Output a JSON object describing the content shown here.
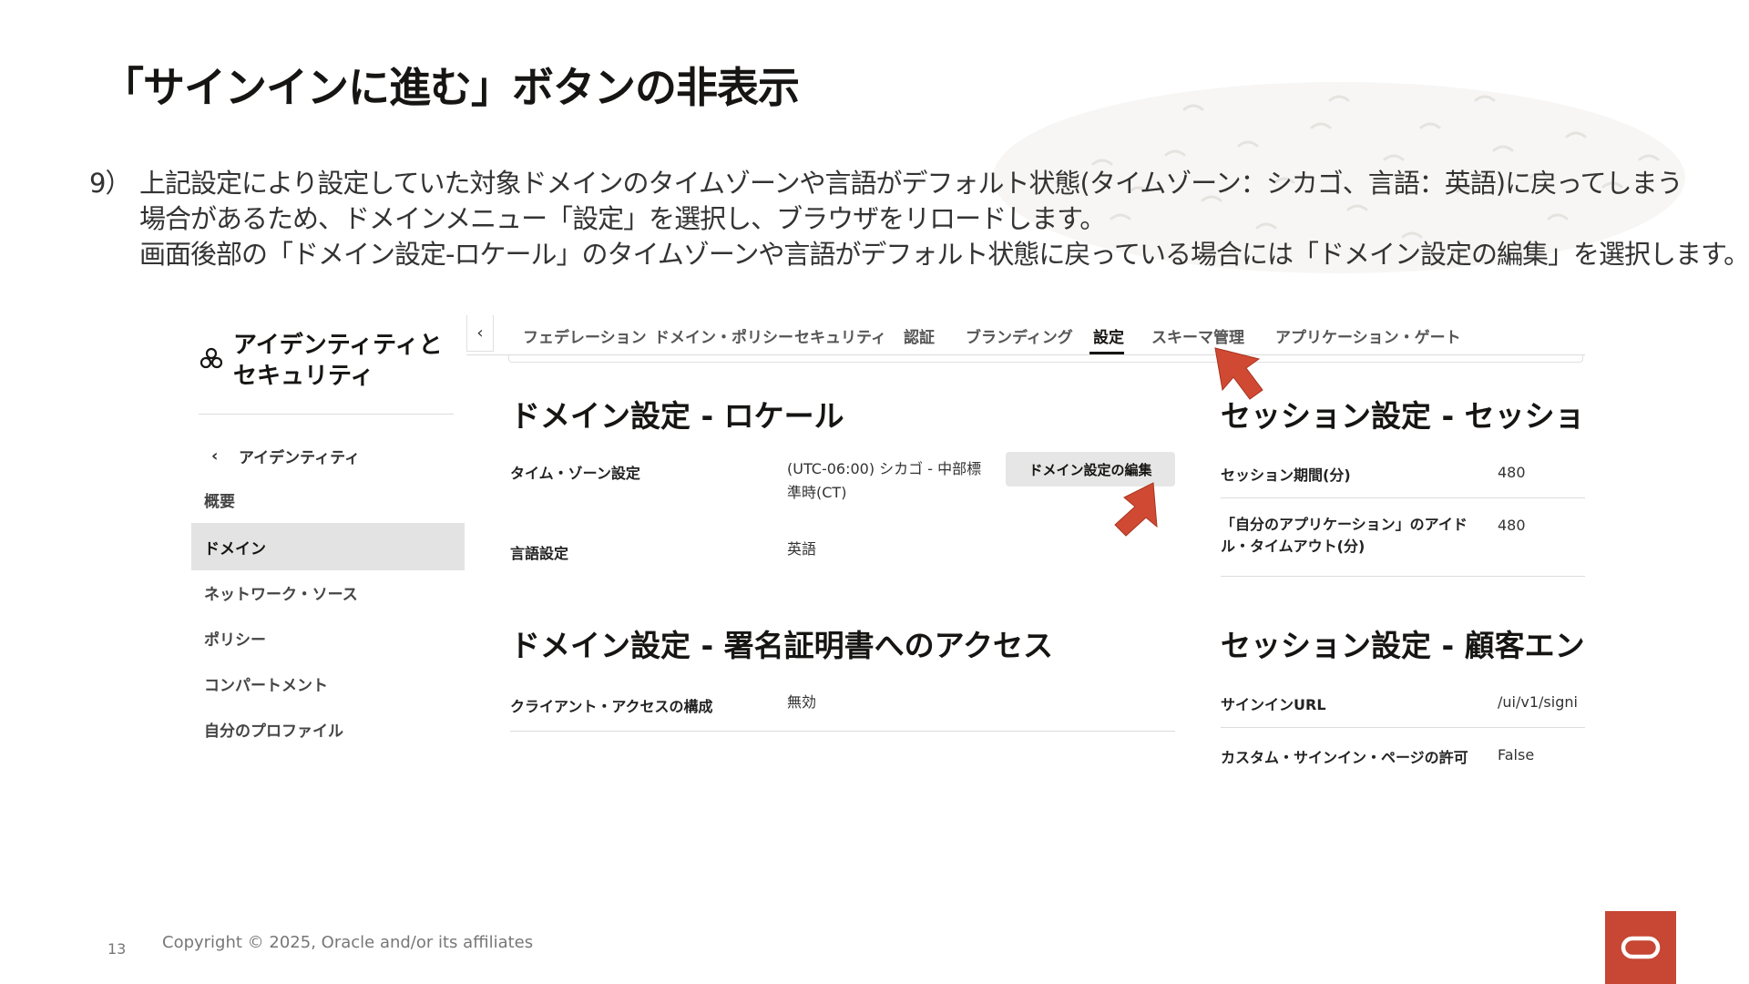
{
  "slide": {
    "title": "「サインインに進む」ボタンの非表示",
    "step_number": "9）",
    "step_lines": [
      "上記設定により設定していた対象ドメインのタイムゾーンや言語がデフォルト状態(タイムゾーン：シカゴ、言語：英語)に戻ってしまう",
      "場合があるため、ドメインメニュー「設定」を選択し、ブラウザをリロードします。",
      "画面後部の「ドメイン設定-ロケール」のタイムゾーンや言語がデフォルト状態に戻っている場合には「ドメイン設定の編集」を選択します。"
    ],
    "page_number": "13",
    "copyright": "Copyright © 2025, Oracle and/or its affiliates"
  },
  "sidebar": {
    "title_line1": "アイデンティティと",
    "title_line2": "セキュリティ",
    "back_label": "アイデンティティ",
    "items": [
      {
        "label": "概要"
      },
      {
        "label": "ドメイン"
      },
      {
        "label": "ネットワーク・ソース"
      },
      {
        "label": "ポリシー"
      },
      {
        "label": "コンパートメント"
      },
      {
        "label": "自分のプロファイル"
      }
    ]
  },
  "tabs": [
    {
      "label": "フェデレーション"
    },
    {
      "label": "ドメイン・ポリシー"
    },
    {
      "label": "セキュリティ"
    },
    {
      "label": "認証"
    },
    {
      "label": "ブランディング"
    },
    {
      "label": "設定"
    },
    {
      "label": "スキーマ管理"
    },
    {
      "label": "アプリケーション・ゲート"
    }
  ],
  "locale": {
    "heading": "ドメイン設定 - ロケール",
    "timezone_label": "タイム・ゾーン設定",
    "timezone_value_line1": "(UTC-06:00) シカゴ - 中部標",
    "timezone_value_line2": "準時(CT)",
    "language_label": "言語設定",
    "language_value": "英語",
    "edit_button": "ドメイン設定の編集"
  },
  "cert": {
    "heading": "ドメイン設定 - 署名証明書へのアクセス",
    "client_label": "クライアント・アクセスの構成",
    "client_value": "無効"
  },
  "session": {
    "heading": "セッション設定 - セッショ",
    "duration_label": "セッション期間(分)",
    "duration_value": "480",
    "idle_label_line1": "「自分のアプリケーション」のアイド",
    "idle_label_line2": "ル・タイムアウト(分)",
    "idle_value": "480"
  },
  "customer": {
    "heading": "セッション設定 - 顧客エン",
    "signin_url_label": "サインインURL",
    "signin_url_value": "/ui/v1/signi",
    "custom_page_label": "カスタム・サインイン・ページの許可",
    "custom_page_value": "False"
  },
  "colors": {
    "accent_arrow": "#d04a33",
    "oracle_red": "#c74634",
    "active_sidebar_bg": "#e3e3e3"
  },
  "icons": {
    "sidebar_logo": "identity-security-icon",
    "back": "chevron-left-icon",
    "annotation": "arrow-pointer-icon",
    "brand": "oracle-logo-icon"
  }
}
